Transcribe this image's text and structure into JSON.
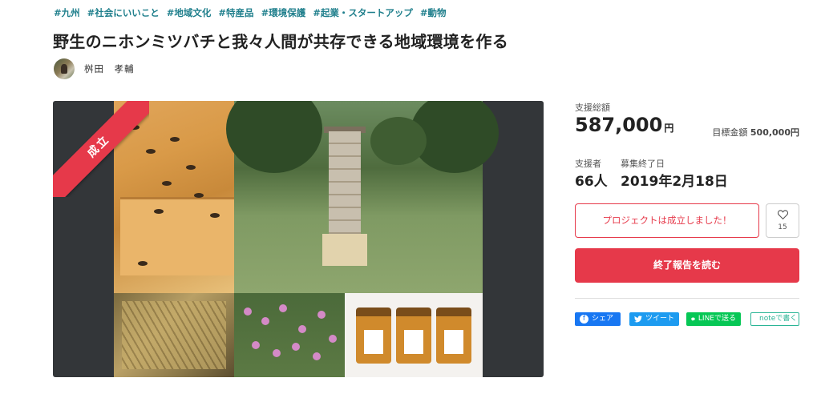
{
  "tags": [
    "#九州",
    "#社会にいいこと",
    "#地域文化",
    "#特産品",
    "#環境保護",
    "#起業・スタートアップ",
    "#動物"
  ],
  "title": "野生のニホンミツバチと我々人間が共存できる地域環境を作る",
  "owner": {
    "name": "桝田　孝輔"
  },
  "gallery": {
    "badge": "成立"
  },
  "stats": {
    "total_label": "支援総額",
    "total_value": "587,000",
    "total_unit": "円",
    "goal_label": "目標金額",
    "goal_value": "500,000円",
    "backers_label": "支援者",
    "backers_value": "66人",
    "deadline_label": "募集終了日",
    "deadline_value": "2019年2月18日"
  },
  "actions": {
    "status_text": "プロジェクトは成立しました！",
    "like_count": "15",
    "report_label": "終了報告を読む"
  },
  "share": {
    "facebook": "シェア",
    "twitter": "ツイート",
    "line": "LINEで送る",
    "note": "noteで書く"
  },
  "colors": {
    "accent": "#e6394a",
    "tag": "#1f7f8c",
    "facebook": "#1877f2",
    "twitter": "#1d9bf0",
    "line": "#06c755",
    "note": "#2bb596"
  }
}
